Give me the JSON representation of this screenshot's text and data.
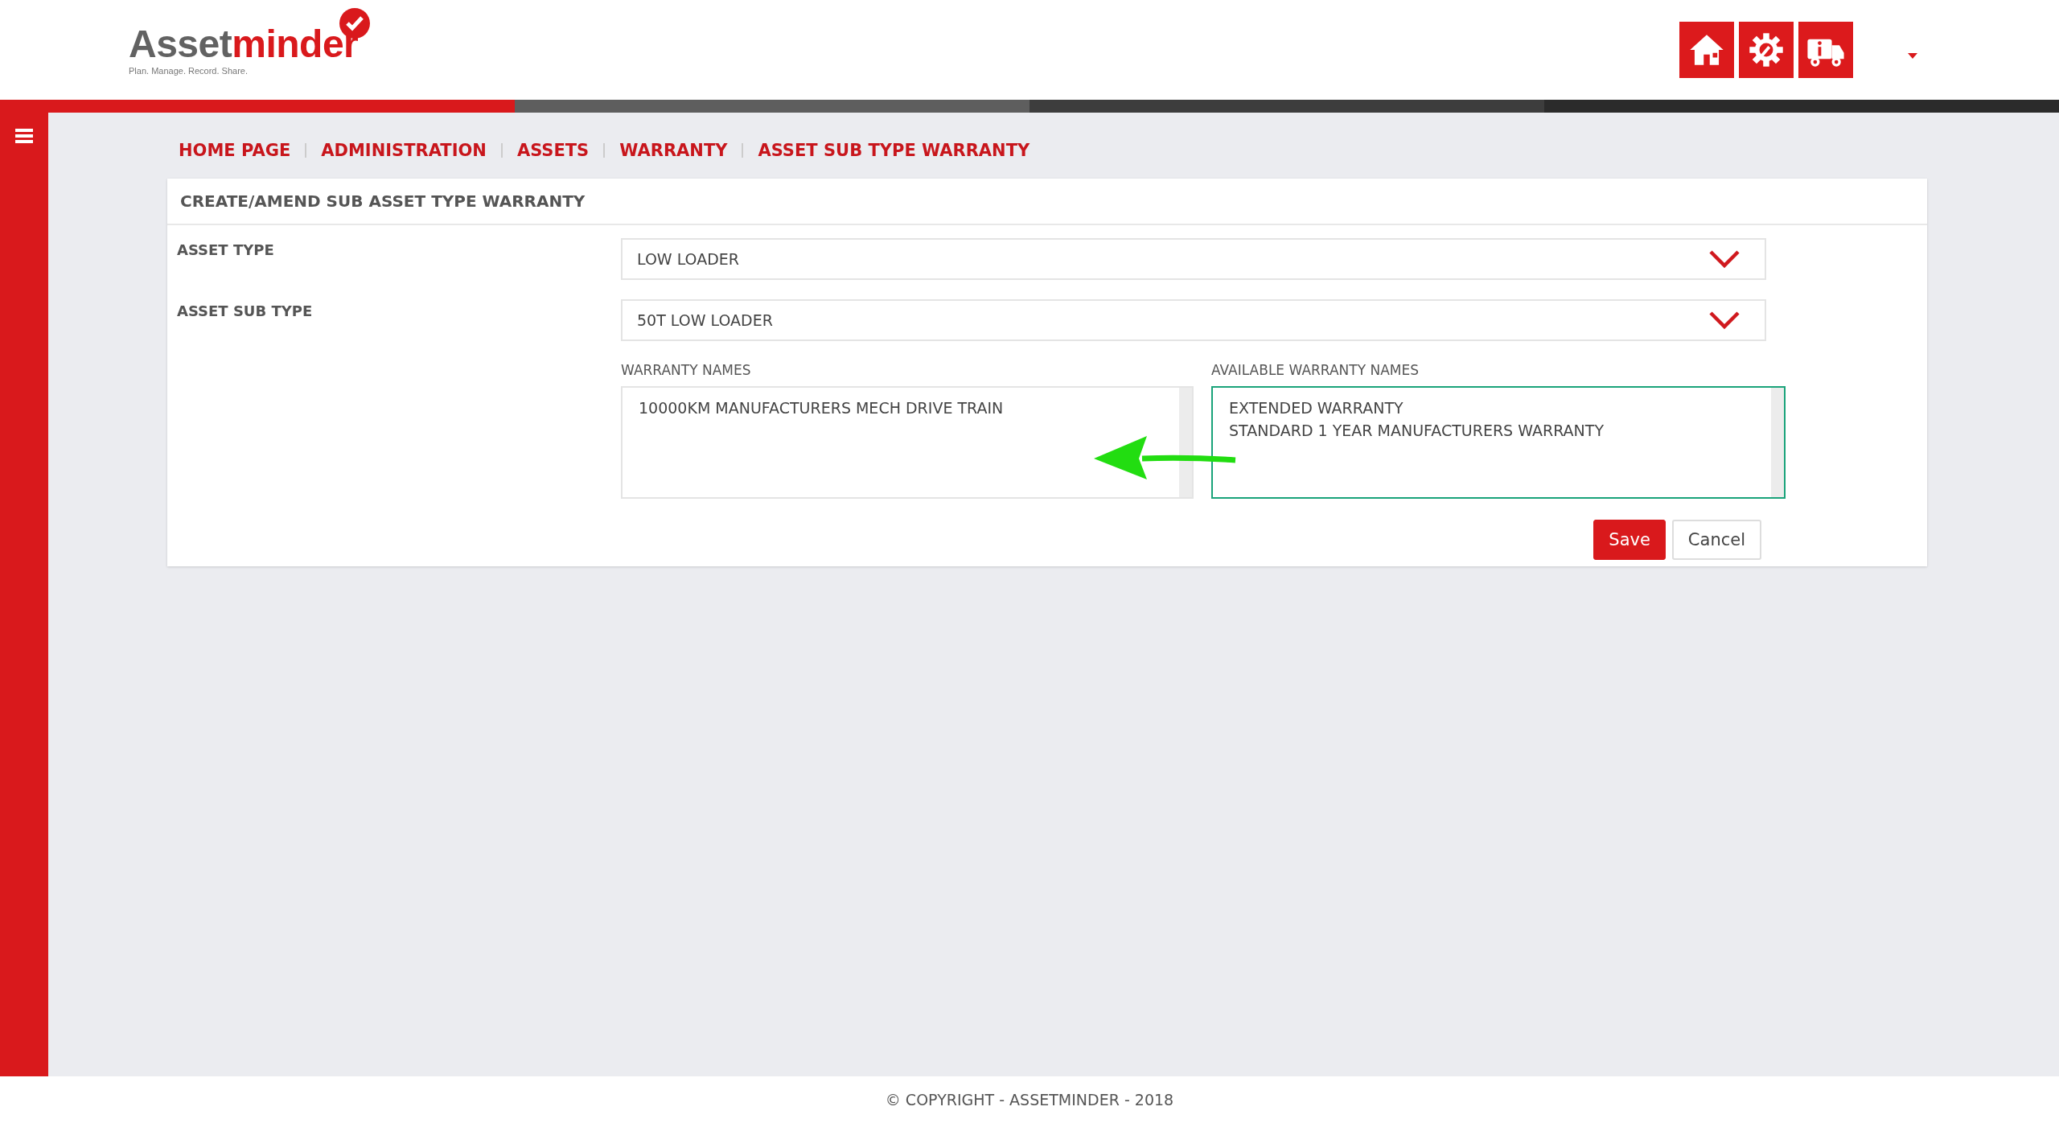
{
  "header": {
    "logo": {
      "prefix": "Asset",
      "suffix": "minder",
      "tagline": "Plan. Manage. Record. Share."
    },
    "icons": [
      {
        "kind": "home"
      },
      {
        "kind": "gear"
      },
      {
        "kind": "truck"
      }
    ]
  },
  "breadcrumb": [
    "HOME PAGE",
    "ADMINISTRATION",
    "ASSETS",
    "WARRANTY",
    "ASSET SUB TYPE WARRANTY"
  ],
  "card": {
    "title": "CREATE/AMEND SUB ASSET TYPE WARRANTY",
    "selects": [
      {
        "label": "ASSET TYPE",
        "value": "LOW LOADER"
      },
      {
        "label": "ASSET SUB TYPE",
        "value": "50T LOW LOADER"
      }
    ],
    "lists": [
      {
        "label": "WARRANTY NAMES",
        "focused": false,
        "items": [
          "10000KM MANUFACTURERS MECH DRIVE TRAIN"
        ]
      },
      {
        "label": "AVAILABLE WARRANTY NAMES",
        "focused": true,
        "items": [
          "EXTENDED WARRANTY",
          "STANDARD 1 YEAR MANUFACTURERS WARRANTY"
        ]
      }
    ],
    "buttons": [
      {
        "label": "Save",
        "kind": "primary"
      },
      {
        "label": "Cancel",
        "kind": "secondary"
      }
    ]
  },
  "footer": "© COPYRIGHT - ASSETMINDER - 2018"
}
